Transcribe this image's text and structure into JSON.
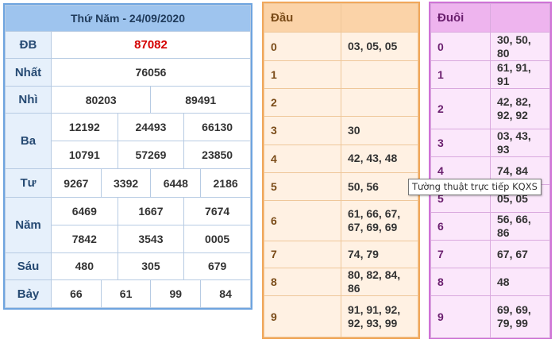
{
  "results": {
    "title": "Thứ Năm - 24/09/2020",
    "rows": [
      {
        "label": "ĐB",
        "values": [
          "87082"
        ]
      },
      {
        "label": "Nhất",
        "values": [
          "76056"
        ]
      },
      {
        "label": "Nhì",
        "values": [
          "80203",
          "89491"
        ]
      },
      {
        "label": "Ba",
        "values": [
          "12192",
          "24493",
          "66130",
          "10791",
          "57269",
          "23850"
        ]
      },
      {
        "label": "Tư",
        "values": [
          "9267",
          "3392",
          "6448",
          "2186"
        ]
      },
      {
        "label": "Năm",
        "values": [
          "6469",
          "1667",
          "7674",
          "7842",
          "3543",
          "0005"
        ]
      },
      {
        "label": "Sáu",
        "values": [
          "480",
          "305",
          "679"
        ]
      },
      {
        "label": "Bảy",
        "values": [
          "66",
          "61",
          "99",
          "84"
        ]
      }
    ]
  },
  "dau": {
    "title": "Đầu",
    "rows": [
      {
        "digit": "0",
        "values": "03, 05, 05"
      },
      {
        "digit": "1",
        "values": ""
      },
      {
        "digit": "2",
        "values": ""
      },
      {
        "digit": "3",
        "values": "30"
      },
      {
        "digit": "4",
        "values": "42, 43, 48"
      },
      {
        "digit": "5",
        "values": "50, 56"
      },
      {
        "digit": "6",
        "values": "61, 66, 67, 67, 69, 69"
      },
      {
        "digit": "7",
        "values": "74, 79"
      },
      {
        "digit": "8",
        "values": "80, 82, 84, 86"
      },
      {
        "digit": "9",
        "values": "91, 91, 92, 92, 93, 99"
      }
    ]
  },
  "duoi": {
    "title": "Đuôi",
    "rows": [
      {
        "digit": "0",
        "values": "30, 50, 80"
      },
      {
        "digit": "1",
        "values": "61, 91, 91"
      },
      {
        "digit": "2",
        "values": "42, 82, 92, 92"
      },
      {
        "digit": "3",
        "values": "03, 43, 93"
      },
      {
        "digit": "4",
        "values": "74, 84"
      },
      {
        "digit": "5",
        "values": "05, 05"
      },
      {
        "digit": "6",
        "values": "56, 66, 86"
      },
      {
        "digit": "7",
        "values": "67, 67"
      },
      {
        "digit": "8",
        "values": "48"
      },
      {
        "digit": "9",
        "values": "69, 69, 79, 99"
      }
    ]
  },
  "tooltip": {
    "text": "Tường thuật trực tiếp KQXS"
  }
}
